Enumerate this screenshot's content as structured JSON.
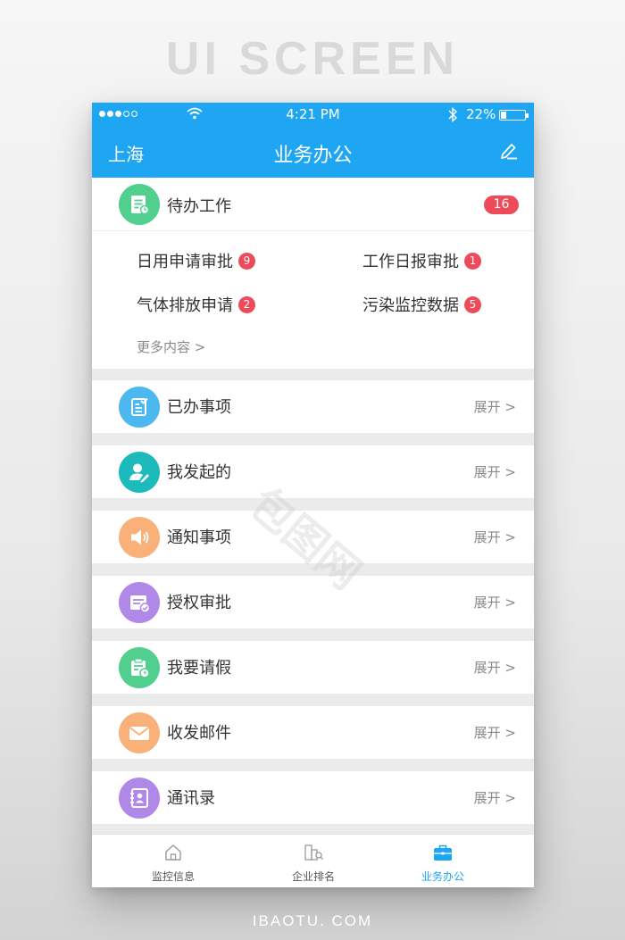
{
  "background": {
    "title": "UI SCREEN",
    "footer": "IBAOTU. COM"
  },
  "status_bar": {
    "time": "4:21 PM",
    "battery": "22%"
  },
  "header": {
    "city": "上海",
    "title": "业务办公"
  },
  "todo": {
    "title": "待办工作",
    "count": "16",
    "items": [
      {
        "label": "日用申请审批",
        "count": "9"
      },
      {
        "label": "工作日报审批",
        "count": "1"
      },
      {
        "label": "气体排放申请",
        "count": "2"
      },
      {
        "label": "污染监控数据",
        "count": "5"
      }
    ],
    "more": "更多内容 >"
  },
  "list": [
    {
      "label": "已办事项",
      "action": "展开 >",
      "icon": "checklist-icon",
      "color": "#4cb8ef"
    },
    {
      "label": "我发起的",
      "action": "展开 >",
      "icon": "user-edit-icon",
      "color": "#1dbabb"
    },
    {
      "label": "通知事项",
      "action": "展开 >",
      "icon": "speaker-icon",
      "color": "#f9b079"
    },
    {
      "label": "授权审批",
      "action": "展开 >",
      "icon": "approval-icon",
      "color": "#b088e7"
    },
    {
      "label": "我要请假",
      "action": "展开 >",
      "icon": "leave-calendar-icon",
      "color": "#50cf8e"
    },
    {
      "label": "收发邮件",
      "action": "展开 >",
      "icon": "mail-icon",
      "color": "#f9b079"
    },
    {
      "label": "通讯录",
      "action": "展开 >",
      "icon": "contacts-icon",
      "color": "#b088e7"
    }
  ],
  "tabs": [
    {
      "label": "监控信息",
      "icon": "home-icon"
    },
    {
      "label": "企业排名",
      "icon": "ranking-icon"
    },
    {
      "label": "业务办公",
      "icon": "briefcase-icon"
    }
  ],
  "watermark": "包图网",
  "colors": {
    "primary": "#1ea6f2",
    "badge": "#ee4b5a",
    "todo_icon": "#50cf8e"
  }
}
